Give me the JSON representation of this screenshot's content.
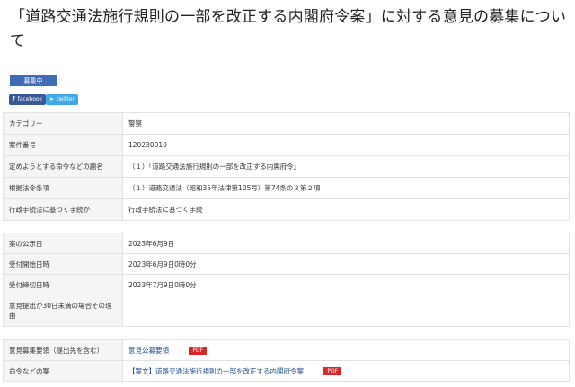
{
  "title": "「道路交通法施行規則の一部を改正する内閣府令案」に対する意見の募集について",
  "status_badge": "募集中",
  "share": {
    "facebook": "facebook",
    "twitter": "twitter"
  },
  "info_table": [
    {
      "label": "カテゴリー",
      "value": "警察"
    },
    {
      "label": "案件番号",
      "value": "120230010"
    },
    {
      "label": "定めようとする命令などの題名",
      "value": "（１）「道路交通法施行規則の一部を改正する内閣府令」"
    },
    {
      "label": "根拠法令条項",
      "value": "（１）道路交通法（昭和35年法律第105号）第74条の３第２項"
    },
    {
      "label": "行政手続法に基づく手続か",
      "value": "行政手続法に基づく手続"
    }
  ],
  "date_table": [
    {
      "label": "案の公示日",
      "value": "2023年6月9日"
    },
    {
      "label": "受付開始日時",
      "value": "2023年6月9日0時0分"
    },
    {
      "label": "受付締切日時",
      "value": "2023年7月9日0時0分"
    },
    {
      "label": "意見提出が30日未満の場合その理由",
      "value": ""
    }
  ],
  "doc_table": [
    {
      "label": "意見募集要領（提出先を含む）",
      "link": "意見公募要領",
      "badge": "PDF"
    },
    {
      "label": "命令などの案",
      "link": "【案文】道路交通法施行規則の一部を改正する内閣府令案",
      "badge": "PDF"
    }
  ],
  "colors": {
    "badge": "#3f6db4",
    "facebook": "#3b5998",
    "twitter": "#41a9e8",
    "pdf": "#d9262b"
  }
}
